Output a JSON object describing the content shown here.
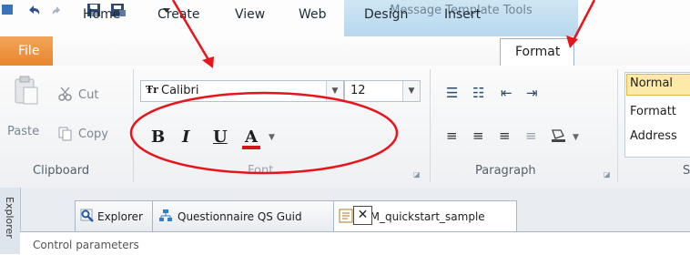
{
  "context_tab_group": {
    "title": "Message Template Tools"
  },
  "tabs": [
    "File",
    "Home",
    "Create",
    "View",
    "Web",
    "Design",
    "Insert",
    "Format"
  ],
  "active_tab": "Format",
  "clipboard": {
    "paste": "Paste",
    "cut": "Cut",
    "copy": "Copy",
    "group_label": "Clipboard"
  },
  "font": {
    "name": "Calibri",
    "size": "12",
    "group_label": "Font",
    "bold": "B",
    "italic": "I",
    "underline": "U",
    "color_letter": "A"
  },
  "paragraph": {
    "group_label": "Paragraph"
  },
  "styles": {
    "items": [
      "Normal",
      "Formatt",
      "Address"
    ],
    "group_label_partial": "S"
  },
  "explorer_panel": {
    "label": "Explorer"
  },
  "doc_tabs": [
    "Explorer",
    "Questionnaire QS Guid",
    "eDM_quickstart_sample"
  ],
  "content": {
    "section_title": "Control parameters"
  },
  "colors": {
    "annotation": "#e8141c",
    "file_tab": "#e9862c",
    "accent": "#2b579a"
  },
  "icons": [
    "save-icon",
    "undo-icon",
    "redo-icon",
    "paste-icon",
    "cut-icon",
    "copy-icon",
    "font-color-icon",
    "bullets-icon",
    "numbering-icon",
    "indent-icon",
    "align-icon",
    "shading-icon",
    "dialog-launcher-icon",
    "close-icon"
  ]
}
